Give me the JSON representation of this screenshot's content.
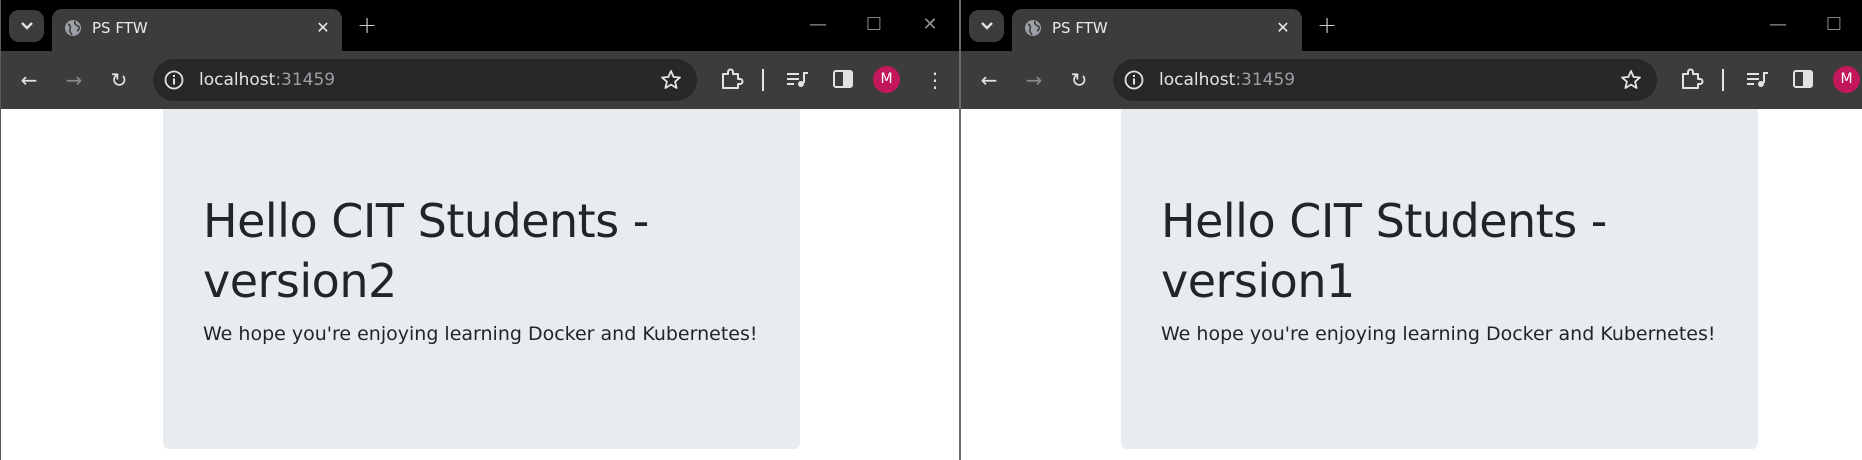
{
  "windows": [
    {
      "tab_title": "PS FTW",
      "address": {
        "host": "localhost",
        "port": ":31459"
      },
      "profile_initial": "M",
      "heading": "Hello CIT Students - version2",
      "lead": "We hope you're enjoying learning Docker and Kubernetes!"
    },
    {
      "tab_title": "PS FTW",
      "address": {
        "host": "localhost",
        "port": ":31459"
      },
      "profile_initial": "M",
      "heading": "Hello CIT Students - version1",
      "lead": "We hope you're enjoying learning Docker and Kubernetes!"
    }
  ],
  "icons": {
    "tab_search": "chevron-down-icon",
    "tab_favicon": "globe-icon",
    "tab_close": "close-icon",
    "new_tab": "plus-icon",
    "back": "arrow-left-icon",
    "forward": "arrow-right-icon",
    "reload": "reload-icon",
    "site_info": "info-icon",
    "bookmark": "star-icon",
    "extensions": "puzzle-icon",
    "media": "media-controls-icon",
    "side_panel": "side-panel-icon",
    "menu": "vertical-dots-icon"
  },
  "colors": {
    "titlebar": "#000000",
    "toolbar": "#3c3c3c",
    "omnibox": "#282828",
    "jumbotron": "#e9ecef",
    "text": "#212529",
    "avatar": "#c2185b"
  }
}
